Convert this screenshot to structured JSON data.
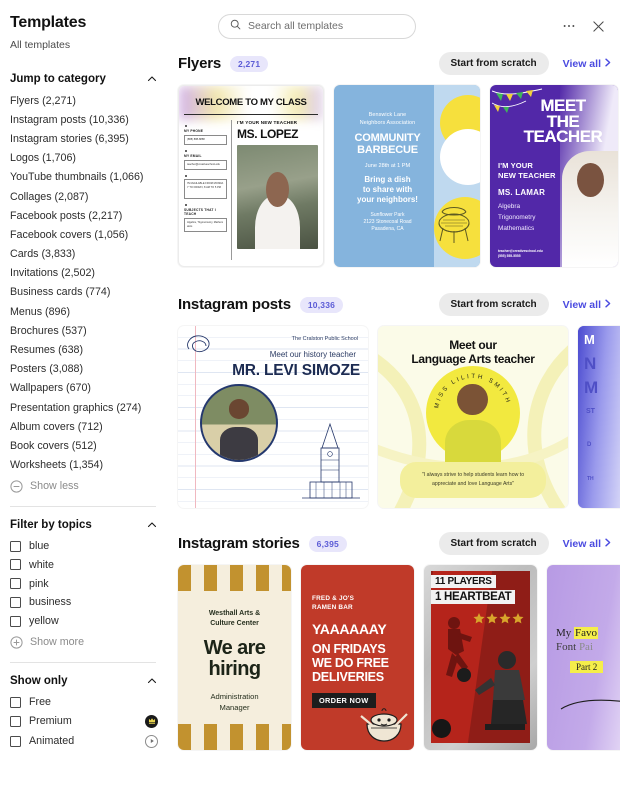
{
  "sidebar": {
    "title": "Templates",
    "subtitle": "All templates",
    "jump": {
      "heading": "Jump to category",
      "chevron": "chevron-up-icon",
      "items": [
        "Flyers (2,271)",
        "Instagram posts (10,336)",
        "Instagram stories (6,395)",
        "Logos (1,706)",
        "YouTube thumbnails (1,066)",
        "Collages (2,087)",
        "Facebook posts (2,217)",
        "Facebook covers (1,056)",
        "Cards (3,833)",
        "Invitations (2,502)",
        "Business cards (774)",
        "Menus (896)",
        "Brochures (537)",
        "Resumes (638)",
        "Posters (3,088)",
        "Wallpapers (670)",
        "Presentation graphics (274)",
        "Album covers (712)",
        "Book covers (512)",
        "Worksheets (1,354)"
      ],
      "toggle": "Show less"
    },
    "topics": {
      "heading": "Filter by topics",
      "items": [
        "blue",
        "white",
        "pink",
        "business",
        "yellow"
      ],
      "toggle": "Show more"
    },
    "show_only": {
      "heading": "Show only",
      "items": [
        {
          "label": "Free",
          "badge": null
        },
        {
          "label": "Premium",
          "badge": "crown-icon"
        },
        {
          "label": "Animated",
          "badge": "play-icon"
        }
      ]
    }
  },
  "topbar": {
    "search_placeholder": "Search all templates",
    "search_value": "",
    "more_icon": "more-horizontal-icon",
    "close_icon": "close-icon"
  },
  "sections": [
    {
      "title": "Flyers",
      "count": "2,271",
      "scratch_label": "Start from scratch",
      "view_all_label": "View all"
    },
    {
      "title": "Instagram posts",
      "count": "10,336",
      "scratch_label": "Start from scratch",
      "view_all_label": "View all"
    },
    {
      "title": "Instagram stories",
      "count": "6,395",
      "scratch_label": "Start from scratch",
      "view_all_label": "View all"
    }
  ],
  "flyers": {
    "card1": {
      "header": "WELCOME TO MY CLASS",
      "phone_label": "MY PHONE",
      "phone_value": "(888) 888-8888",
      "email_label": "MY EMAIL",
      "email_value": "teacher@creativeschool.edu",
      "hours": "I'M AVAILABLE FROM MONDAY TO FRIDAY, 8 AM TO 5 PM",
      "subjects_label": "SUBJECTS THAT I TEACH",
      "subjects_value": "Algebra, Trigonometry, Mathematics",
      "intro": "I'M YOUR NEW TEACHER",
      "name": "MS. LOPEZ"
    },
    "card2": {
      "assoc": "Benswick Lane\nNeighbors Association",
      "title": "COMMUNITY\nBARBECUE",
      "date": "June 28th at 1 PM",
      "message": "Bring a dish\nto share with\nyour neighbors!",
      "address": "Sunflower Park\n2123 Stonecoal Road\nPasadena, CA"
    },
    "card3": {
      "title": "MEET\nTHE\nTEACHER",
      "intro": "I'M YOUR\nNEW TEACHER",
      "name": "MS. LAMAR",
      "subjects": "Algebra\nTrigonometry\nMathematics",
      "contact": "teacher@creativeschool.edu\n(555) 555-5555"
    }
  },
  "ig_posts": {
    "card1": {
      "school": "The Cralston Public School",
      "meet": "Meet our history teacher",
      "name": "MR. LEVI SIMOZE"
    },
    "card2": {
      "title": "Meet our\nLanguage Arts teacher",
      "ring_text": "MISS LILITH SMITH",
      "quote": "\"I always strive to help students learn how to appreciate and love Language Arts\""
    },
    "card3": {
      "cut_off_label": "M"
    }
  },
  "ig_stories": {
    "card1": {
      "org": "Westhall Arts &\nCulture Center",
      "headline": "We are\nhiring",
      "role": "Administration\nManager"
    },
    "card2": {
      "brand": "FRED & JO'S\nRAMEN BAR",
      "yay": "YAAAAAAY",
      "message": "ON FRIDAYS\nWE DO FREE\nDELIVERIES",
      "cta": "ORDER NOW"
    },
    "card3": {
      "line1": "11 PLAYERS",
      "line2": "1 HEARTBEAT"
    },
    "card4": {
      "line1_a": "My ",
      "line1_b": "Favo",
      "line2_a": "Font ",
      "line2_b": "Pai",
      "part": "Part 2"
    }
  },
  "colors": {
    "accent": "#4a4ae0",
    "badge_bg": "#e8e6fb",
    "badge_text": "#5b5bd6",
    "button_bg": "#ebebeb"
  }
}
